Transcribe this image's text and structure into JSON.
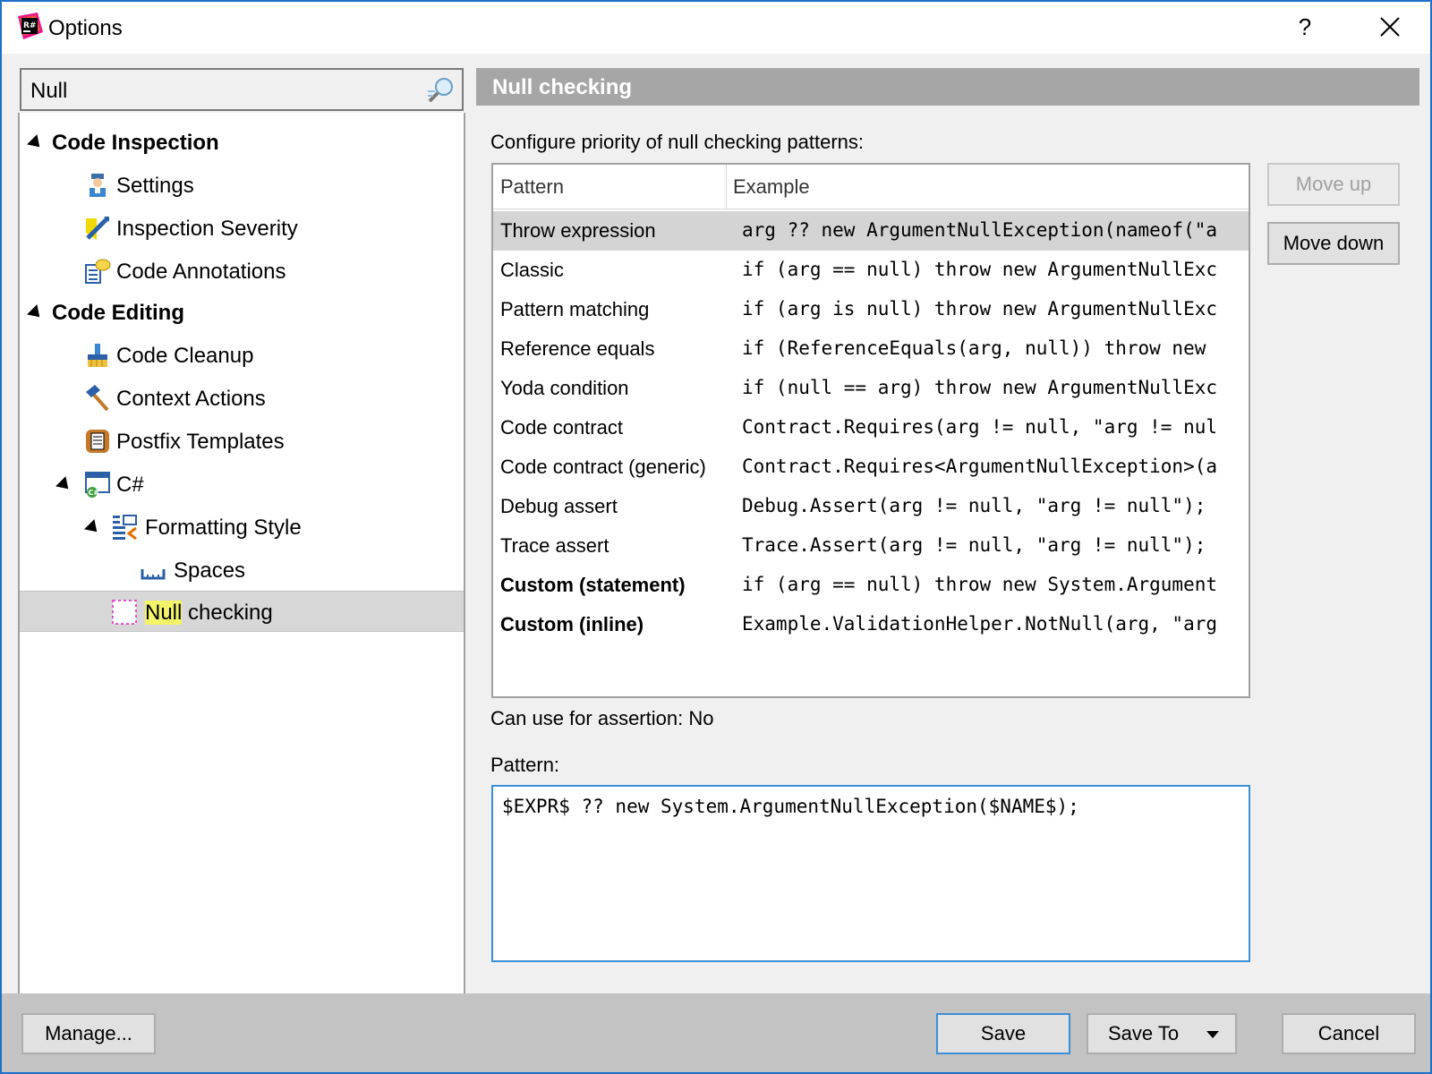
{
  "window": {
    "title": "Options",
    "help_glyph": "?",
    "close_icon": "close-icon"
  },
  "search": {
    "value": "Null",
    "icon": "search-icon"
  },
  "tree": {
    "code_inspection": "Code Inspection",
    "settings": "Settings",
    "inspection_severity": "Inspection Severity",
    "code_annotations": "Code Annotations",
    "code_editing": "Code Editing",
    "code_cleanup": "Code Cleanup",
    "context_actions": "Context Actions",
    "postfix_templates": "Postfix Templates",
    "csharp": "C#",
    "formatting_style": "Formatting Style",
    "spaces": "Spaces",
    "null_checking_highlight": "Null",
    "null_checking_rest": " checking"
  },
  "panel": {
    "title": "Null checking",
    "configure_label": "Configure priority of null checking patterns:",
    "columns": {
      "pattern": "Pattern",
      "example": "Example"
    },
    "rows": [
      {
        "pattern": "Throw expression",
        "example": "arg ?? new ArgumentNullException(nameof(\"a"
      },
      {
        "pattern": "Classic",
        "example": "if (arg == null) throw new ArgumentNullExc"
      },
      {
        "pattern": "Pattern matching",
        "example": "if (arg is null) throw new ArgumentNullExc"
      },
      {
        "pattern": "Reference equals",
        "example": "if (ReferenceEquals(arg, null)) throw new"
      },
      {
        "pattern": "Yoda condition",
        "example": "if (null == arg) throw new ArgumentNullExc"
      },
      {
        "pattern": "Code contract",
        "example": "Contract.Requires(arg != null, \"arg != nul"
      },
      {
        "pattern": "Code contract (generic)",
        "example": "Contract.Requires<ArgumentNullException>(a"
      },
      {
        "pattern": "Debug assert",
        "example": "Debug.Assert(arg != null, \"arg != null\");"
      },
      {
        "pattern": "Trace assert",
        "example": "Trace.Assert(arg != null, \"arg != null\");"
      },
      {
        "pattern": "Custom (statement)",
        "example": "if (arg == null) throw new System.Argument"
      },
      {
        "pattern": "Custom (inline)",
        "example": "Example.ValidationHelper.NotNull(arg, \"arg"
      }
    ],
    "move_up": "Move up",
    "move_down": "Move down",
    "assertion_label": "Can use for assertion: No",
    "pattern_label": "Pattern:",
    "pattern_value": "$EXPR$ ?? new System.ArgumentNullException($NAME$);"
  },
  "footer": {
    "manage": "Manage...",
    "save": "Save",
    "save_to": "Save To",
    "cancel": "Cancel"
  }
}
